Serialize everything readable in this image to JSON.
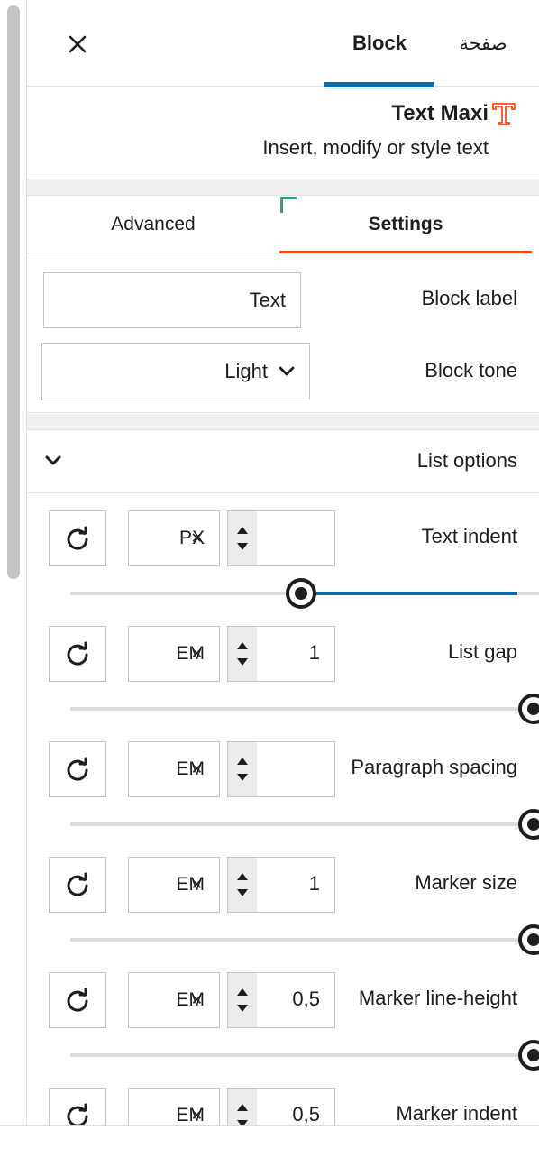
{
  "header": {
    "tab_block": "Block",
    "tab_page": "صفحة"
  },
  "block": {
    "title": "Text Maxi",
    "description": "Insert, modify or style text",
    "icon": "text-maxi-logo-icon",
    "icon_color": "#ff4a17"
  },
  "tabs": {
    "advanced": "Advanced",
    "settings": "Settings"
  },
  "fields": {
    "block_label_label": "Block label",
    "block_label_value": "Text",
    "block_tone_label": "Block tone",
    "block_tone_value": "Light"
  },
  "list_options": {
    "title": "List options",
    "rows": [
      {
        "label": "Text indent",
        "unit": "PX",
        "value": "",
        "slider_fraction": 0.5
      },
      {
        "label": "List gap",
        "unit": "EM",
        "value": "1",
        "slider_fraction": 1.0
      },
      {
        "label": "Paragraph spacing",
        "unit": "EM",
        "value": "",
        "slider_fraction": 1.0
      },
      {
        "label": "Marker size",
        "unit": "EM",
        "value": "1",
        "slider_fraction": 1.0
      },
      {
        "label": "Marker line-height",
        "unit": "EM",
        "value": "0,5",
        "slider_fraction": 1.0
      },
      {
        "label": "Marker indent",
        "unit": "EM",
        "value": "0,5",
        "slider_fraction": 1.0
      }
    ]
  },
  "colors": {
    "accent_blue": "#0a6bb1",
    "accent_orange": "#ff4a17",
    "corner_green": "#36a373"
  }
}
